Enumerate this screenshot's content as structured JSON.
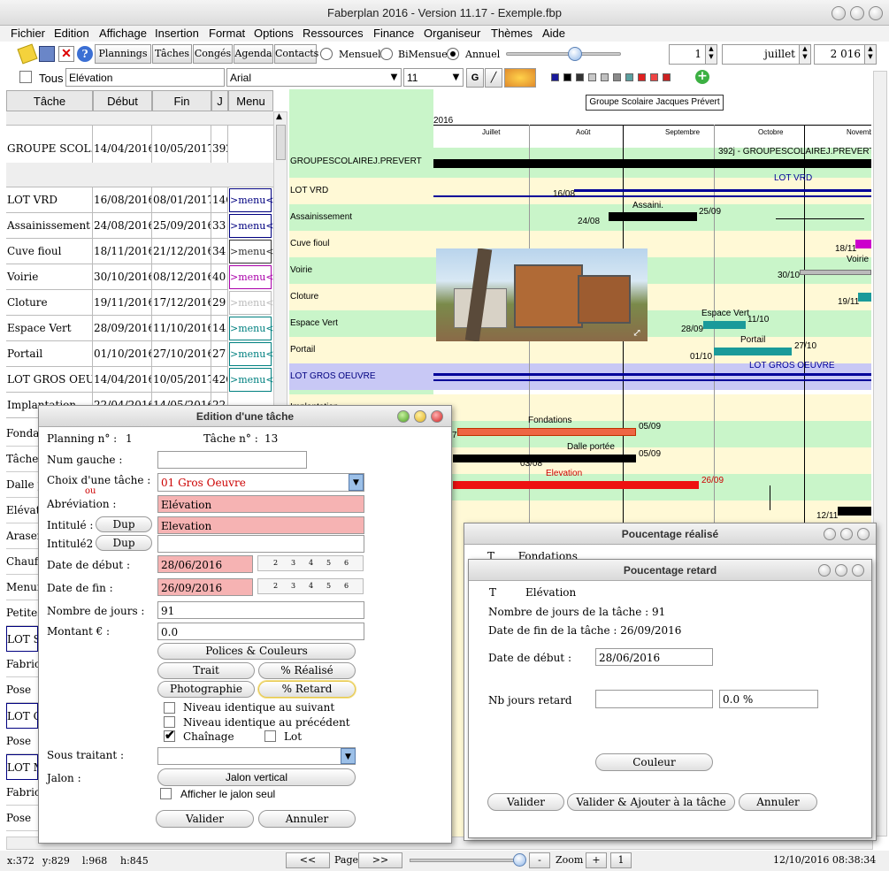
{
  "window": {
    "title": "Faberplan 2016 - Version 11.17 - Exemple.fbp"
  },
  "menu": [
    "Fichier",
    "Edition",
    "Affichage",
    "Insertion",
    "Format",
    "Options",
    "Ressources",
    "Finance",
    "Organiseur",
    "Thèmes",
    "Aide"
  ],
  "toolbar": {
    "views": [
      "Plannings",
      "Tâches",
      "Congés",
      "Agenda",
      "Contacts"
    ],
    "modes": [
      "Mensuel",
      "BiMensuel",
      "Annuel"
    ],
    "selected_mode": "Annuel",
    "day": "1",
    "month": "juillet",
    "year": "2 016"
  },
  "formatbar": {
    "all_label": "Tous",
    "task_field": "Elévation",
    "font": "Arial",
    "size": "11",
    "bold": "G",
    "palette": [
      "#1a1a9a",
      "#000000",
      "#333333",
      "#c8c8c8",
      "#c0c0c0",
      "#8a8a8a",
      "#5ba0a0",
      "#e02020",
      "#ee4444",
      "#cc2222"
    ]
  },
  "table": {
    "headers": [
      "Tâche",
      "Début",
      "Fin",
      "J",
      "Menu"
    ],
    "rows": [
      {
        "task": "GROUPE SCOL...",
        "start": "14/04/2016",
        "end": "10/05/2017",
        "days": "392",
        "menu": ""
      },
      {
        "task": "LOT VRD",
        "start": "16/08/2016",
        "end": "08/01/2017",
        "days": "146",
        "menu": ">menu<"
      },
      {
        "task": "Assainissement",
        "start": "24/08/2016",
        "end": "25/09/2016",
        "days": "33",
        "menu": ">menu<"
      },
      {
        "task": "Cuve fioul",
        "start": "18/11/2016",
        "end": "21/12/2016",
        "days": "34",
        "menu": ">menu<"
      },
      {
        "task": "Voirie",
        "start": "30/10/2016",
        "end": "08/12/2016",
        "days": "40",
        "menu": ">menu<"
      },
      {
        "task": "Cloture",
        "start": "19/11/2016",
        "end": "17/12/2016",
        "days": "29",
        "menu": ">menu<"
      },
      {
        "task": "Espace Vert",
        "start": "28/09/2016",
        "end": "11/10/2016",
        "days": "14",
        "menu": ">menu<"
      },
      {
        "task": "Portail",
        "start": "01/10/2016",
        "end": "27/10/2016",
        "days": "27",
        "menu": ">menu<"
      },
      {
        "task": "LOT GROS OEU...",
        "start": "14/04/2016",
        "end": "10/05/2017",
        "days": "426",
        "menu": ">menu<"
      },
      {
        "task": "Implantation",
        "start": "22/04/2016",
        "end": "14/05/2016",
        "days": "22",
        "menu": ""
      }
    ],
    "menu_colors": [
      "#000080",
      "#000080",
      "#333333",
      "#aa00aa",
      "#bbbbbb",
      "#008080",
      "#008080",
      "#008080",
      "#000080"
    ],
    "left_labels": [
      "Fondat",
      "Tâche",
      "Dalle p",
      "Elévati",
      "Arasen",
      "Chauff",
      "Menuis",
      "Petites",
      "LOT SE",
      "Fabrica",
      "Pose",
      "LOT C",
      "Pose",
      "LOT M",
      "Fabrica",
      "Pose"
    ]
  },
  "gantt": {
    "banner": "Groupe Scolaire Jacques Prévert",
    "year": "2016",
    "months": [
      "Juillet",
      "Août",
      "Septembre",
      "Octobre",
      "Novemb"
    ],
    "rows": [
      {
        "label": "GROUPESCOLAIREJ.PREVERT",
        "bar_label": "392j - GROUPESCOLAIREJ.PREVERT"
      },
      {
        "label": "LOT VRD",
        "bar_label": "LOT VRD",
        "date_start": "16/08"
      },
      {
        "label": "Assainissement",
        "bar_label": "Assaini.",
        "date_start": "24/08",
        "date_end": "25/09"
      },
      {
        "label": "Cuve fioul",
        "date_end": "18/11"
      },
      {
        "label": "Voirie",
        "bar_label": "Voirie",
        "date_start": "30/10"
      },
      {
        "label": "Cloture",
        "date_end": "19/11"
      },
      {
        "label": "Espace Vert",
        "bar_label": "Espace Vert",
        "date_start": "28/09",
        "date_end": "11/10"
      },
      {
        "label": "Portail",
        "bar_label": "Portail",
        "date_start": "01/10",
        "date_end": "27/10"
      },
      {
        "label": "LOT GROS OEUVRE",
        "bar_label": "LOT GROS OEUVRE"
      },
      {
        "label": "Implantation"
      },
      {
        "label": "",
        "bar_label": "Fondations",
        "date_start": "7",
        "date_end": "05/09"
      },
      {
        "label": "",
        "bar_label": "Dalle portée",
        "date_start": "03/08",
        "date_end": "05/09"
      },
      {
        "label": "",
        "bar_label": "Elevation",
        "date_end": "26/09"
      },
      {
        "label": "",
        "date_end": "12/11"
      }
    ]
  },
  "dialog_task": {
    "title": "Edition d'une tâche",
    "planning_label": "Planning n° :",
    "planning_value": "1",
    "task_num_label": "Tâche n° :",
    "task_num_value": "13",
    "num_gauche_label": "Num gauche :",
    "choix_label": "Choix d'une tâche :",
    "ou": "ou",
    "choix_value": "01 Gros Oeuvre",
    "abrev_label": "Abréviation :",
    "abrev_value": "Elévation",
    "intitule_label": "Intitulé :",
    "intitule_value": "Elevation",
    "intitule2_label": "Intitulé2 :",
    "dup": "Dup",
    "start_label": "Date de début :",
    "start_value": "28/06/2016",
    "end_label": "Date de fin :",
    "end_value": "26/09/2016",
    "days_label": "Nombre de jours :",
    "days_value": "91",
    "amount_label": "Montant € :",
    "amount_value": "0.0",
    "weekdays": [
      "2",
      "3",
      "4",
      "5",
      "6"
    ],
    "btn_fonts": "Polices  &  Couleurs",
    "btn_trait": "Trait",
    "btn_realise": "% Réalisé",
    "btn_photo": "Photographie",
    "btn_retard": "% Retard",
    "cb_next": "Niveau identique au suivant",
    "cb_prev": "Niveau identique au précédent",
    "cb_chain": "Chaînage",
    "cb_lot": "Lot",
    "sub_label": "Sous traitant :",
    "jalon_label": "Jalon :",
    "btn_jalon": "Jalon vertical",
    "cb_jalon": "Afficher le jalon seul",
    "ok": "Valider",
    "cancel": "Annuler"
  },
  "dialog_realise": {
    "title": "Poucentage réalisé",
    "line": "T       Fondations"
  },
  "dialog_retard": {
    "title": "Poucentage retard",
    "t": "T",
    "task": "Elévation",
    "nb_days": "Nombre de jours de la tâche : 91",
    "end_date": "Date de fin de la tâche : 26/09/2016",
    "start_label": "Date de début :",
    "start_value": "28/06/2016",
    "delay_label": "Nb jours retard",
    "percent": "0.0 %",
    "color_btn": "Couleur",
    "ok": "Valider",
    "ok_add": "Valider & Ajouter à la tâche",
    "cancel": "Annuler"
  },
  "status": {
    "x": "x:372",
    "y": "y:829",
    "l": "l:968",
    "h": "h:845",
    "prev": "<<",
    "page": "Page",
    "next": ">>",
    "minus": "-",
    "zoom": "Zoom",
    "plus": "+",
    "one": "1",
    "datetime": "12/10/2016 08:38:34"
  }
}
